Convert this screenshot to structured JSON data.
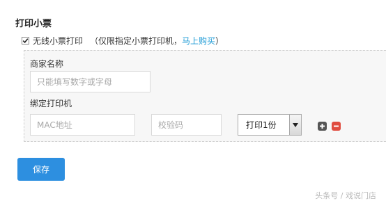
{
  "section": {
    "title": "打印小票"
  },
  "wireless": {
    "checked": true,
    "label": "无线小票打印",
    "note_prefix": "（仅限指定小票打印机，",
    "buy_link": "马上购买",
    "note_suffix": "）"
  },
  "merchant": {
    "label": "商家名称",
    "placeholder": "只能填写数字或字母",
    "value": ""
  },
  "bind_printer": {
    "label": "绑定打印机",
    "mac_placeholder": "MAC地址",
    "code_placeholder": "校验码",
    "copies_selected": "打印1份"
  },
  "actions": {
    "save_label": "保存"
  },
  "icons": {
    "checkbox": "checkmark-icon",
    "dropdown": "chevron-down-icon",
    "add": "plus-icon",
    "remove": "minus-icon"
  },
  "colors": {
    "link": "#1e9bd6",
    "save_button": "#2d8fe0",
    "remove_button": "#e04b3f",
    "add_button": "#555555",
    "panel_background": "#f7f7f7"
  },
  "watermark": "头条号 / 戏说门店"
}
